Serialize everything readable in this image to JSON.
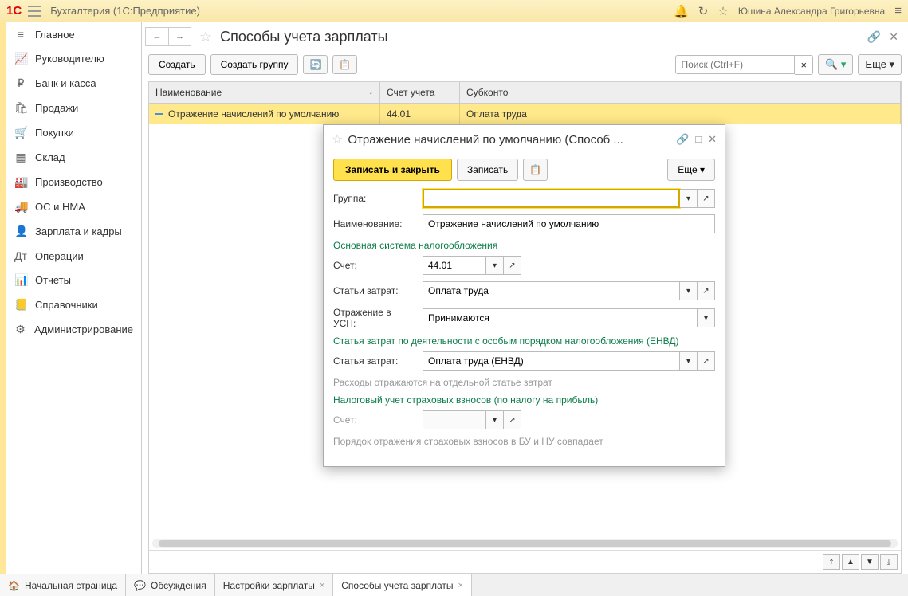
{
  "header": {
    "app_title": "Бухгалтерия  (1С:Предприятие)",
    "user": "Юшина Александра Григорьевна"
  },
  "sidebar": {
    "items": [
      {
        "label": "Главное",
        "icon": "≡"
      },
      {
        "label": "Руководителю",
        "icon": "📈"
      },
      {
        "label": "Банк и касса",
        "icon": "₽"
      },
      {
        "label": "Продажи",
        "icon": "🛍"
      },
      {
        "label": "Покупки",
        "icon": "🛒"
      },
      {
        "label": "Склад",
        "icon": "▦"
      },
      {
        "label": "Производство",
        "icon": "🏭"
      },
      {
        "label": "ОС и НМА",
        "icon": "🚚"
      },
      {
        "label": "Зарплата и кадры",
        "icon": "👤"
      },
      {
        "label": "Операции",
        "icon": "Дт"
      },
      {
        "label": "Отчеты",
        "icon": "📊"
      },
      {
        "label": "Справочники",
        "icon": "📒"
      },
      {
        "label": "Администрирование",
        "icon": "⚙"
      }
    ]
  },
  "window": {
    "title": "Способы учета зарплаты",
    "toolbar": {
      "create": "Создать",
      "create_group": "Создать группу",
      "search_placeholder": "Поиск (Ctrl+F)",
      "more": "Еще"
    },
    "table": {
      "columns": {
        "name": "Наименование",
        "account": "Счет учета",
        "sub": "Субконто"
      },
      "rows": [
        {
          "name": "Отражение начислений по умолчанию",
          "account": "44.01",
          "sub": "Оплата труда"
        }
      ]
    }
  },
  "dialog": {
    "title": "Отражение начислений по умолчанию (Способ ...",
    "toolbar": {
      "save_close": "Записать и закрыть",
      "save": "Записать",
      "more": "Еще"
    },
    "labels": {
      "group": "Группа:",
      "name": "Наименование:",
      "section_main": "Основная система налогообложения",
      "account": "Счет:",
      "cost_item": "Статьи затрат:",
      "usn": "Отражение в УСН:",
      "section_envd": "Статья затрат по деятельности с особым порядком налогообложения (ЕНВД)",
      "cost_item2": "Статья затрат:",
      "note1": "Расходы отражаются на отдельной статье затрат",
      "section_tax": "Налоговый учет страховых взносов (по налогу на прибыль)",
      "account2": "Счет:",
      "note2": "Порядок отражения страховых взносов в БУ и НУ совпадает"
    },
    "values": {
      "group": "",
      "name": "Отражение начислений по умолчанию",
      "account": "44.01",
      "cost_item": "Оплата труда",
      "usn": "Принимаются",
      "cost_item2": "Оплата труда (ЕНВД)",
      "account2": ""
    }
  },
  "bottom_tabs": [
    {
      "label": "Начальная страница",
      "icon": "🏠",
      "closable": false
    },
    {
      "label": "Обсуждения",
      "icon": "💬",
      "closable": false
    },
    {
      "label": "Настройки зарплаты",
      "closable": true
    },
    {
      "label": "Способы учета зарплаты",
      "closable": true,
      "active": true
    }
  ]
}
